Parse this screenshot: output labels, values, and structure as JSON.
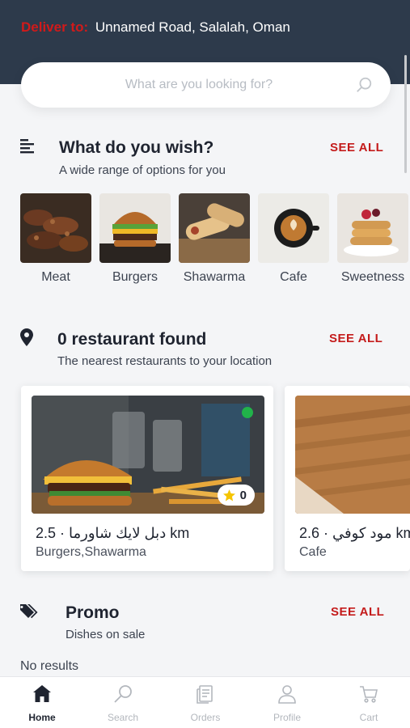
{
  "header": {
    "deliver_label": "Deliver to:",
    "address": "Unnamed Road, Salalah, Oman"
  },
  "search": {
    "placeholder": "What are you looking for?"
  },
  "categories_section": {
    "title": "What do you wish?",
    "subtitle": "A wide range of options for you",
    "see_all": "SEE ALL",
    "items": [
      {
        "label": "Meat"
      },
      {
        "label": "Burgers"
      },
      {
        "label": "Shawarma"
      },
      {
        "label": "Cafe"
      },
      {
        "label": "Sweetness"
      }
    ]
  },
  "restaurants_section": {
    "title": "0 restaurant found",
    "subtitle": "The nearest restaurants to your location",
    "see_all": "SEE ALL",
    "items": [
      {
        "name": "دبل لايك شاورما · 2.5 km",
        "tags": "Burgers,Shawarma",
        "rating": "0"
      },
      {
        "name": "مود كوفي · 2.6 km",
        "tags": "Cafe"
      }
    ]
  },
  "promo_section": {
    "title": "Promo",
    "subtitle": "Dishes on sale",
    "see_all": "SEE ALL",
    "empty_text": "No results"
  },
  "bottom_nav": {
    "items": [
      {
        "label": "Home",
        "icon": "home-icon",
        "active": true
      },
      {
        "label": "Search",
        "icon": "search-icon",
        "active": false
      },
      {
        "label": "Orders",
        "icon": "orders-icon",
        "active": false
      },
      {
        "label": "Profile",
        "icon": "profile-icon",
        "active": false
      },
      {
        "label": "Cart",
        "icon": "cart-icon",
        "active": false
      }
    ]
  },
  "colors": {
    "header_bg": "#2d3a4b",
    "accent_red": "#c41b1b",
    "online_green": "#21b34a",
    "star_yellow": "#f5c400"
  }
}
